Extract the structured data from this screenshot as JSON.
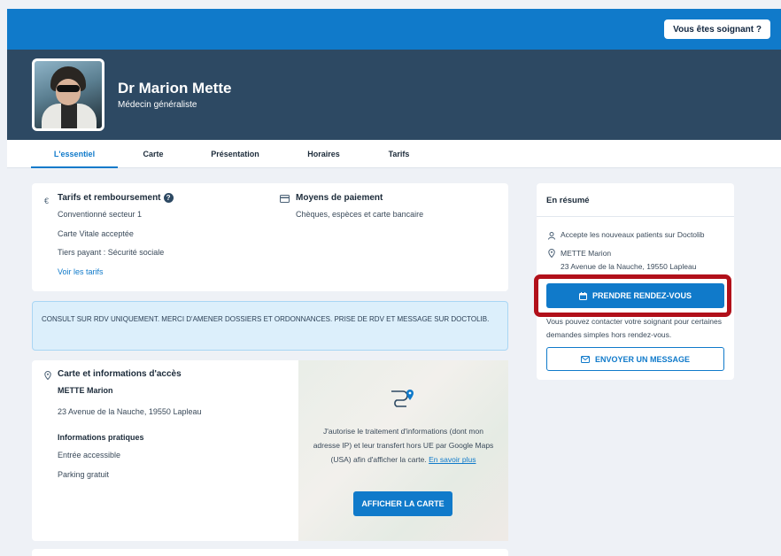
{
  "topbar": {
    "caregiver_button": "Vous êtes soignant ?"
  },
  "doctor": {
    "name": "Dr Marion Mette",
    "specialty": "Médecin généraliste"
  },
  "tabs": [
    {
      "label": "L'essentiel",
      "active": true
    },
    {
      "label": "Carte"
    },
    {
      "label": "Présentation"
    },
    {
      "label": "Horaires"
    },
    {
      "label": "Tarifs"
    }
  ],
  "fees": {
    "icon": "€",
    "title": "Tarifs et remboursement",
    "lines": [
      "Conventionné secteur 1",
      "Carte Vitale acceptée",
      "Tiers payant : Sécurité sociale"
    ],
    "link": "Voir les tarifs"
  },
  "payment": {
    "title": "Moyens de paiement",
    "text": "Chèques, espèces et carte bancaire"
  },
  "notice": "CONSULT SUR RDV UNIQUEMENT. MERCI D'AMENER DOSSIERS ET ORDONNANCES. PRISE DE RDV ET MESSAGE SUR DOCTOLIB.",
  "access": {
    "title": "Carte et informations d'accès",
    "name": "METTE Marion",
    "address": "23 Avenue de la Nauche, 19550 Lapleau",
    "practical_title": "Informations pratiques",
    "practical": [
      "Entrée accessible",
      "Parking gratuit"
    ]
  },
  "map": {
    "consent": "J'autorise le traitement d'informations (dont mon adresse IP) et leur transfert hors UE par Google Maps (USA) afin d'afficher la carte.",
    "consent_link": "En savoir plus",
    "button": "AFFICHER LA CARTE"
  },
  "summary": {
    "title": "En résumé",
    "new_patients": "Accepte les nouveaux patients sur Doctolib",
    "name": "METTE Marion",
    "address": "23 Avenue de la Nauche, 19550 Lapleau",
    "book_button": "PRENDRE RENDEZ-VOUS",
    "contact_text": "Vous pouvez contacter votre soignant pour certaines demandes simples hors rendez-vous.",
    "message_button": "ENVOYER UN MESSAGE"
  },
  "colors": {
    "brand_blue": "#107aca",
    "header_navy": "#2d4963",
    "highlight_red": "#b1101a"
  }
}
